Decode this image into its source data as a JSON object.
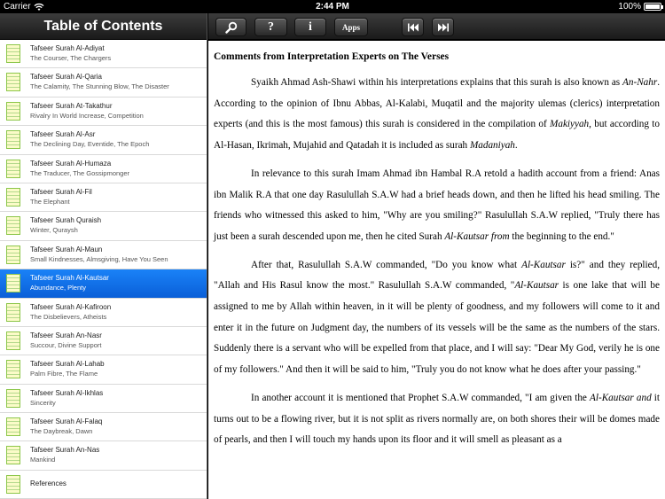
{
  "status": {
    "carrier": "Carrier",
    "time": "2:44 PM",
    "battery": "100%"
  },
  "sidebar": {
    "title": "Table of Contents",
    "items": [
      {
        "title": "Tafseer Surah Al-Adiyat",
        "sub": "The Courser, The Chargers"
      },
      {
        "title": "Tafseer Surah Al-Qaria",
        "sub": "The Calamity, The Stunning Blow, The Disaster"
      },
      {
        "title": "Tafseer Surah At-Takathur",
        "sub": "Rivalry In World Increase, Competition"
      },
      {
        "title": "Tafseer Surah Al-Asr",
        "sub": "The Declining Day, Eventide, The Epoch"
      },
      {
        "title": "Tafseer Surah Al-Humaza",
        "sub": "The Traducer, The Gossipmonger"
      },
      {
        "title": "Tafseer Surah Al-Fil",
        "sub": "The Elephant"
      },
      {
        "title": "Tafseer Surah Quraish",
        "sub": "Winter, Quraysh"
      },
      {
        "title": "Tafseer Surah Al-Maun",
        "sub": "Small Kindnesses, Almsgiving, Have You Seen"
      },
      {
        "title": "Tafseer Surah Al-Kautsar",
        "sub": "Abundance, Plenty"
      },
      {
        "title": "Tafseer Surah Al-Kafiroon",
        "sub": "The Disbelievers, Atheists"
      },
      {
        "title": "Tafseer Surah An-Nasr",
        "sub": "Succour, Divine Support"
      },
      {
        "title": "Tafseer Surah Al-Lahab",
        "sub": "Palm Fibre, The Flame"
      },
      {
        "title": "Tafseer Surah Al-Ikhlas",
        "sub": "Sincerity"
      },
      {
        "title": "Tafseer Surah Al-Falaq",
        "sub": "The Daybreak, Dawn"
      },
      {
        "title": "Tafseer Surah An-Nas",
        "sub": "Mankind"
      },
      {
        "title": "References",
        "sub": ""
      }
    ],
    "selected_index": 8,
    "selected_color": "#1a82f7"
  },
  "toolbar": {
    "search_icon": "magnifier-icon",
    "help_label": "?",
    "info_label": "i",
    "apps_label": "Apps",
    "prev_icon": "skip-back-icon",
    "next_icon": "skip-forward-icon"
  },
  "content": {
    "heading": "Comments from Interpretation Experts on The Verses",
    "p1_a": "Syaikh Ahmad Ash-Shawi within his interpretations explains that this surah is also known as ",
    "p1_b": "An-Nahr",
    "p1_c": ". According to the opinion of Ibnu Abbas, Al-Kalabi, Muqatil and the majority ulemas (clerics) interpretation experts (and this is the most famous) this surah is considered in the compilation of ",
    "p1_d": "Makiyyah",
    "p1_e": ", but according to Al-Hasan, Ikrimah, Mujahid and Qatadah it is included as surah ",
    "p1_f": "Madaniyah",
    "p1_g": ".",
    "p2_a": " In relevance to this surah Imam Ahmad ibn Hambal R.A retold a hadith account from a friend: Anas ibn Malik R.A that one day Rasulullah S.A.W had a brief heads down, and then he lifted his head smiling. The friends who witnessed this asked to him, \"Why are you smiling?\" Rasulullah S.A.W replied, \"Truly there has just been a surah descended upon me, then he cited Surah ",
    "p2_b": "Al-Kautsar from",
    "p2_c": " the beginning to the end.\"",
    "p3_a": "After that, Rasulullah S.A.W commanded, \"Do you know what ",
    "p3_b": "Al-Kautsar",
    "p3_c": " is?\" and they replied, \"Allah and His Rasul know the most.\" Rasulullah S.A.W commanded, \"",
    "p3_d": "Al-Kautsar",
    "p3_e": " is one lake that will be assigned to me by Allah within heaven, in it will be plenty of goodness, and my followers will come to it and enter it in the future on Judgment day, the numbers of its vessels will be the same as the numbers of the stars. Suddenly there is a servant who will be expelled from that place, and I will say: \"Dear My God, verily he is one of my followers.\" And then it will be said to him, \"Truly you do not know what he does after your passing.\"",
    "p4_a": "In another account it is mentioned that Prophet S.A.W commanded, \"I am given the ",
    "p4_b": "Al-Kautsar and",
    "p4_c": " it turns out to be a flowing river, but it is not split as rivers normally are, on both shores their will be domes made of pearls, and then I will touch my hands upon its floor and it will smell as pleasant as a"
  }
}
